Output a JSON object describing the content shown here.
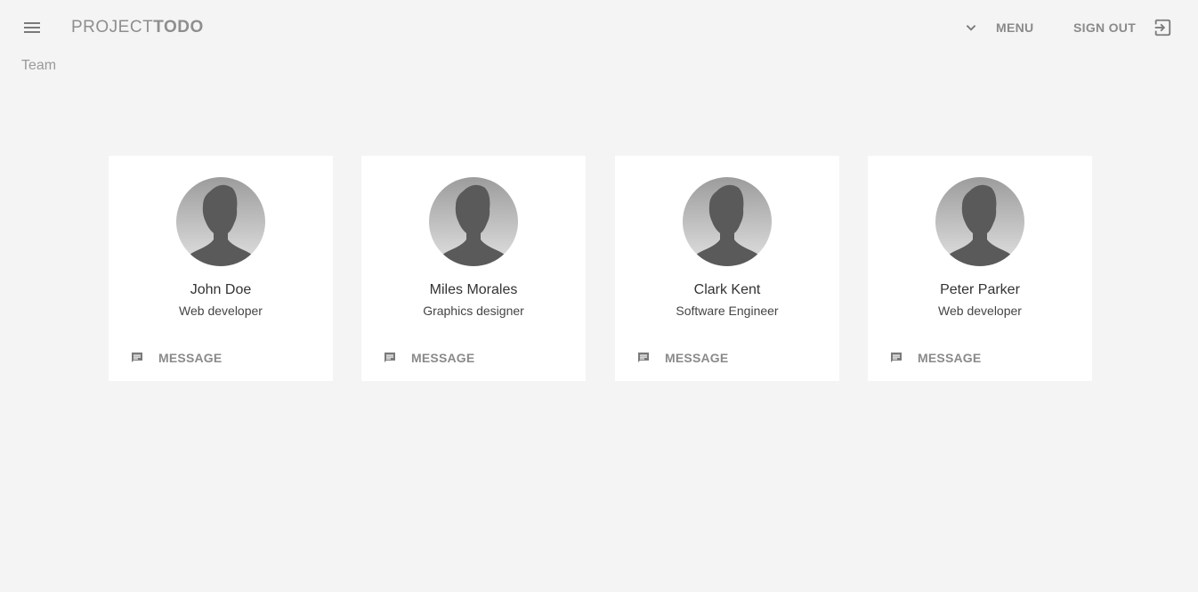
{
  "header": {
    "brand_prefix": "PROJECT",
    "brand_suffix": "TODO",
    "menu_label": "MENU",
    "signout_label": "SIGN OUT"
  },
  "page": {
    "title": "Team"
  },
  "members": [
    {
      "name": "John Doe",
      "role": "Web developer",
      "action_label": "MESSAGE"
    },
    {
      "name": "Miles Morales",
      "role": "Graphics designer",
      "action_label": "MESSAGE"
    },
    {
      "name": "Clark Kent",
      "role": "Software Engineer",
      "action_label": "MESSAGE"
    },
    {
      "name": "Peter Parker",
      "role": "Web developer",
      "action_label": "MESSAGE"
    }
  ],
  "icons": {
    "hamburger": "menu-icon",
    "chevron": "chevron-down-icon",
    "exit": "exit-to-app-icon",
    "chat": "chat-icon",
    "avatar": "person-silhouette"
  },
  "colors": {
    "background": "#f4f4f4",
    "card": "#ffffff",
    "muted_text": "#8a8a8a",
    "silhouette": "#5a5a5a"
  }
}
